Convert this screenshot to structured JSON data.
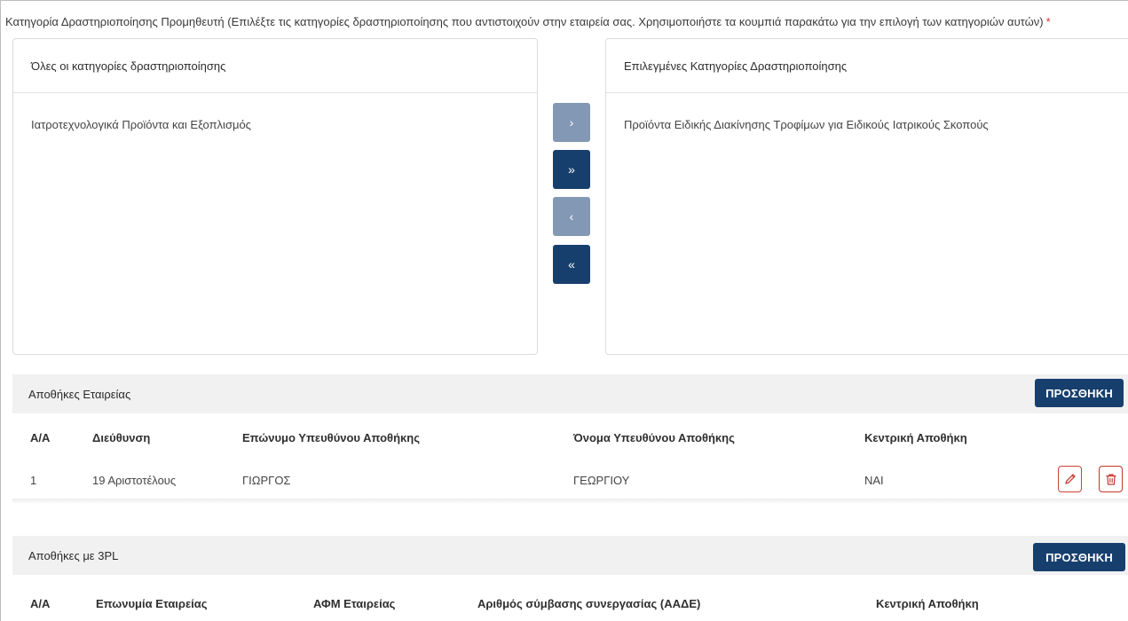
{
  "categories_label": "Κατηγορία Δραστηριοποίησης Προμηθευτή (Επιλέξτε τις κατηγορίες δραστηριοποίησης που αντιστοιχούν στην εταιρεία σας. Χρησιμοποιήστε τα κουμπιά παρακάτω για την επιλογή των κατηγοριών αυτών)",
  "required_mark": "*",
  "all_categories": {
    "title": "Όλες οι κατηγορίες δραστηριοποίησης",
    "items": [
      "Ιατροτεχνολογικά Προϊόντα και Εξοπλισμός"
    ]
  },
  "selected_categories": {
    "title": "Επιλεγμένες Κατηγορίες Δραστηριοποίησης",
    "items": [
      "Προϊόντα Ειδικής Διακίνησης Τροφίμων για Ειδικούς Ιατρικούς Σκοπούς"
    ]
  },
  "transfer_buttons": {
    "move_right": "›",
    "move_all_right": "»",
    "move_left": "‹",
    "move_all_left": "«"
  },
  "warehouses": {
    "title": "Αποθήκες Εταιρείας",
    "add_label": "ΠΡΟΣΘΗΚΗ",
    "columns": [
      "Α/Α",
      "Διεύθυνση",
      "Επώνυμο Υπευθύνου Αποθήκης",
      "Όνομα Υπευθύνου Αποθήκης",
      "Κεντρική Αποθήκη"
    ],
    "rows": [
      [
        "1",
        "19 Αριστοτέλους",
        "ΓΙΩΡΓΟΣ",
        "ΓΕΩΡΓΙΟΥ",
        "ΝΑΙ"
      ]
    ]
  },
  "warehouses_3pl": {
    "title": "Αποθήκες με 3PL",
    "add_label": "ΠΡΟΣΘΗΚΗ",
    "columns": [
      "Α/Α",
      "Επωνυμία Εταιρείας",
      "ΑΦΜ Εταιρείας",
      "Αριθμός σύμβασης συνεργασίας (ΑΑΔΕ)",
      "Κεντρική Αποθήκη"
    ]
  },
  "icons": {
    "edit": "pencil-icon",
    "delete": "trash-icon"
  },
  "colors": {
    "primary": "#173f6e",
    "primary_disabled": "#8398b4",
    "danger": "#c0392b",
    "section_bg": "#f1f1f1"
  }
}
